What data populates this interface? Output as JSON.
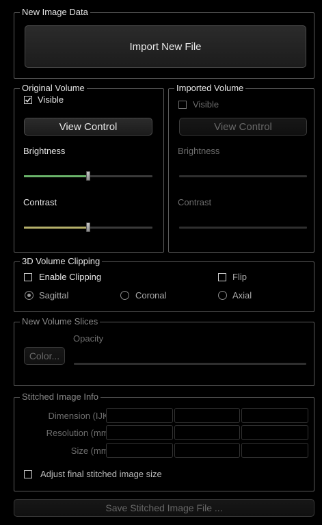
{
  "new_image_data": {
    "title": "New Image Data",
    "import_button": "Import New File"
  },
  "original_volume": {
    "title": "Original Volume",
    "visible_label": "Visible",
    "visible_checked": true,
    "view_control": "View Control",
    "brightness_label": "Brightness",
    "brightness_level": 0.5,
    "contrast_label": "Contrast",
    "contrast_level": 0.5,
    "brightness_color": "#6ab36a",
    "contrast_color": "#b5b06a"
  },
  "imported_volume": {
    "title": "Imported Volume",
    "visible_label": "Visible",
    "visible_checked": false,
    "view_control": "View Control",
    "brightness_label": "Brightness",
    "contrast_label": "Contrast"
  },
  "clipping": {
    "title": "3D Volume Clipping",
    "enable_label": "Enable Clipping",
    "flip_label": "Flip",
    "sagittal_label": "Sagittal",
    "coronal_label": "Coronal",
    "axial_label": "Axial",
    "selected": "Sagittal"
  },
  "new_slices": {
    "title": "New Volume Slices",
    "color_button": "Color...",
    "opacity_label": "Opacity"
  },
  "stitched_info": {
    "title": "Stitched Image Info",
    "rows": [
      {
        "label": "Dimension (IJK)"
      },
      {
        "label": "Resolution (mm)"
      },
      {
        "label": "Size (mm)"
      }
    ],
    "adjust_label": "Adjust final stitched image size"
  },
  "save_button": "Save Stitched Image File ..."
}
